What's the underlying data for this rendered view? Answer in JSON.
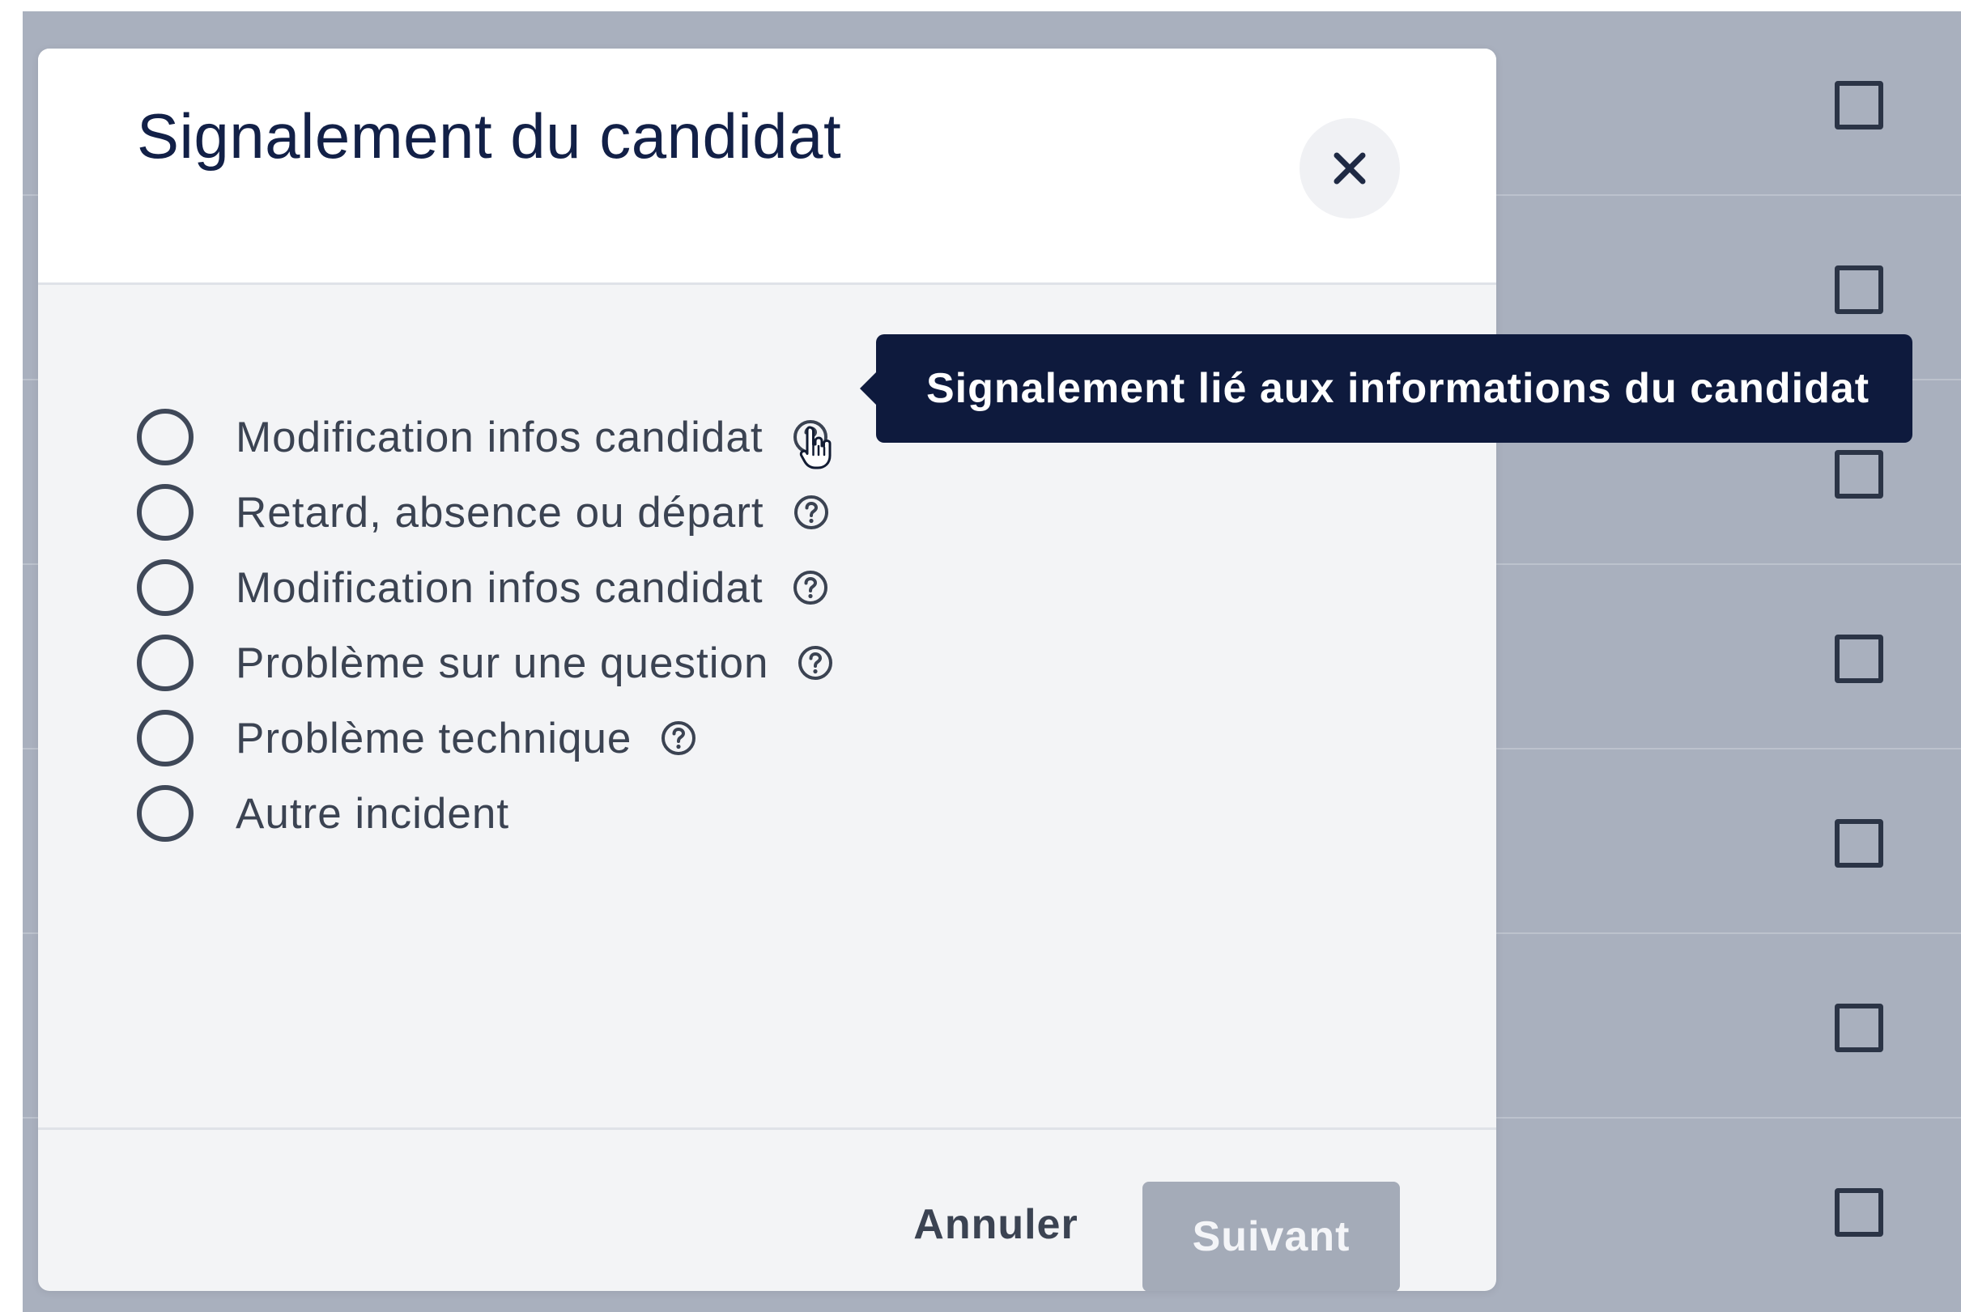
{
  "modal": {
    "title": "Signalement du candidat",
    "close_icon": "close-icon",
    "options": [
      {
        "label": "Modification infos candidat",
        "help": true
      },
      {
        "label": "Retard, absence ou départ",
        "help": true
      },
      {
        "label": "Modification infos candidat",
        "help": true
      },
      {
        "label": "Problème sur une question",
        "help": true
      },
      {
        "label": "Problème technique",
        "help": true
      },
      {
        "label": "Autre incident",
        "help": false
      }
    ],
    "tooltip": "Signalement lié aux informations du candidat",
    "footer": {
      "cancel_label": "Annuler",
      "next_label": "Suivant"
    }
  },
  "colors": {
    "overlay": "#a9b0be",
    "title": "#122047",
    "tooltip_bg": "#0e1a3d",
    "disabled_button": "#a4abb8"
  },
  "icons": {
    "help": "question-circle-icon",
    "cursor": "hand-pointer-icon",
    "close": "close-icon"
  }
}
